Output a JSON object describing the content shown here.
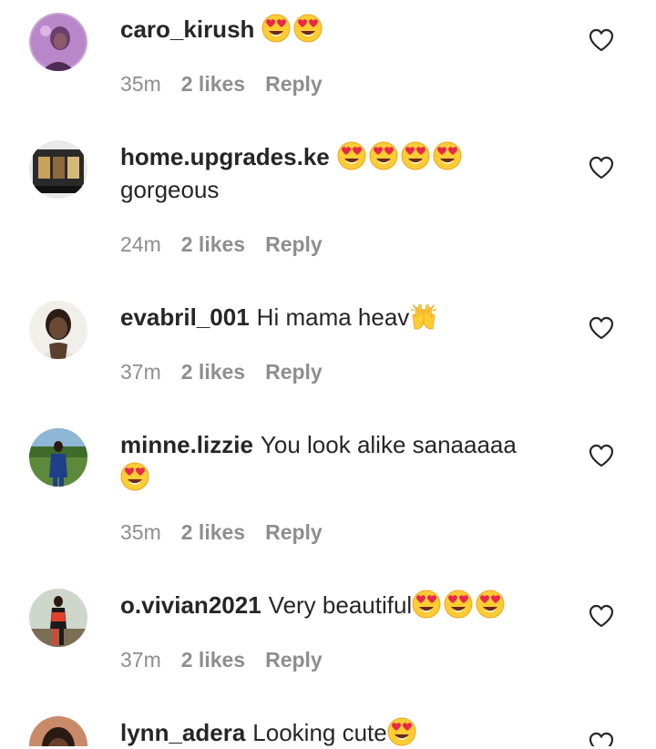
{
  "comments": [
    {
      "username": "caro_kirush",
      "text": "",
      "text2": "",
      "emoji_count": 2,
      "emoji_type": "heart-eyes",
      "time": "35m",
      "likes": "2 likes",
      "reply": "Reply"
    },
    {
      "username": "home.upgrades.ke",
      "text": "",
      "text2": "gorgeous",
      "emoji_count": 4,
      "emoji_type": "heart-eyes",
      "time": "24m",
      "likes": "2 likes",
      "reply": "Reply"
    },
    {
      "username": "evabril_001",
      "text": "Hi mama heav",
      "text2": "",
      "emoji_count": 1,
      "emoji_type": "raising-hands",
      "time": "37m",
      "likes": "2 likes",
      "reply": "Reply"
    },
    {
      "username": "minne.lizzie",
      "text": "You look alike sanaaaaa",
      "text2": "",
      "emoji_count": 1,
      "emoji_type": "heart-eyes",
      "time": "35m",
      "likes": "2 likes",
      "reply": "Reply"
    },
    {
      "username": "o.vivian2021",
      "text": "Very beautiful",
      "text2": "",
      "emoji_count": 3,
      "emoji_type": "heart-eyes",
      "time": "37m",
      "likes": "2 likes",
      "reply": "Reply"
    },
    {
      "username": "lynn_adera",
      "text": "Looking cute",
      "text2": "",
      "emoji_count": 1,
      "emoji_type": "heart-eyes",
      "time": "",
      "likes": "",
      "reply": ""
    }
  ],
  "colors": {
    "text": "#262626",
    "meta": "#8e8e8e",
    "emoji_face": "#ffcc33",
    "emoji_heart": "#e8274b"
  }
}
